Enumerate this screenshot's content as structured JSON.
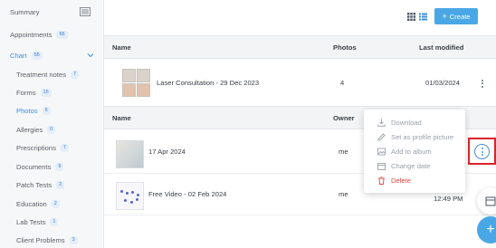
{
  "sidebar": {
    "top_items": [
      {
        "label": "Summary",
        "count": ""
      },
      {
        "label": "Appointments",
        "count": "66"
      },
      {
        "label": "Chart",
        "count": "55"
      }
    ],
    "sub_items": [
      {
        "label": "Treatment notes",
        "count": "7"
      },
      {
        "label": "Forms",
        "count": "15"
      },
      {
        "label": "Photos",
        "count": "6"
      },
      {
        "label": "Allergies",
        "count": "0"
      },
      {
        "label": "Prescriptions",
        "count": "7"
      },
      {
        "label": "Documents",
        "count": "9"
      },
      {
        "label": "Patch Tests",
        "count": "2"
      },
      {
        "label": "Education",
        "count": "2"
      },
      {
        "label": "Lab Tests",
        "count": "1"
      },
      {
        "label": "Client Problems",
        "count": "3"
      }
    ]
  },
  "toolbar": {
    "create_label": "Create",
    "create_icon": "plus"
  },
  "albums_table": {
    "headers": {
      "name": "Name",
      "photos": "Photos",
      "last_modified": "Last modified"
    },
    "rows": [
      {
        "name": "Laser Consultation - 29 Dec 2023",
        "photos": "4",
        "last_modified": "01/03/2024"
      }
    ]
  },
  "photos_table": {
    "headers": {
      "name": "Name",
      "owner": "Owner"
    },
    "rows": [
      {
        "name": "17 Apr 2024",
        "owner": "me",
        "date": ""
      },
      {
        "name": "Free Video - 02 Feb 2024",
        "owner": "me",
        "date": "12:49 PM"
      }
    ]
  },
  "context_menu": {
    "items": [
      {
        "label": "Download",
        "icon": "download-icon",
        "danger": false
      },
      {
        "label": "Set as profile picture",
        "icon": "edit-icon",
        "danger": false
      },
      {
        "label": "Add to album",
        "icon": "image-icon",
        "danger": false
      },
      {
        "label": "Change date",
        "icon": "calendar-icon",
        "danger": false
      },
      {
        "label": "Delete",
        "icon": "trash-icon",
        "danger": true
      }
    ]
  },
  "colors": {
    "accent": "#4aa7e6",
    "active_link": "#3d8fe0",
    "danger": "#e0443e",
    "highlight": "#d9242a"
  }
}
